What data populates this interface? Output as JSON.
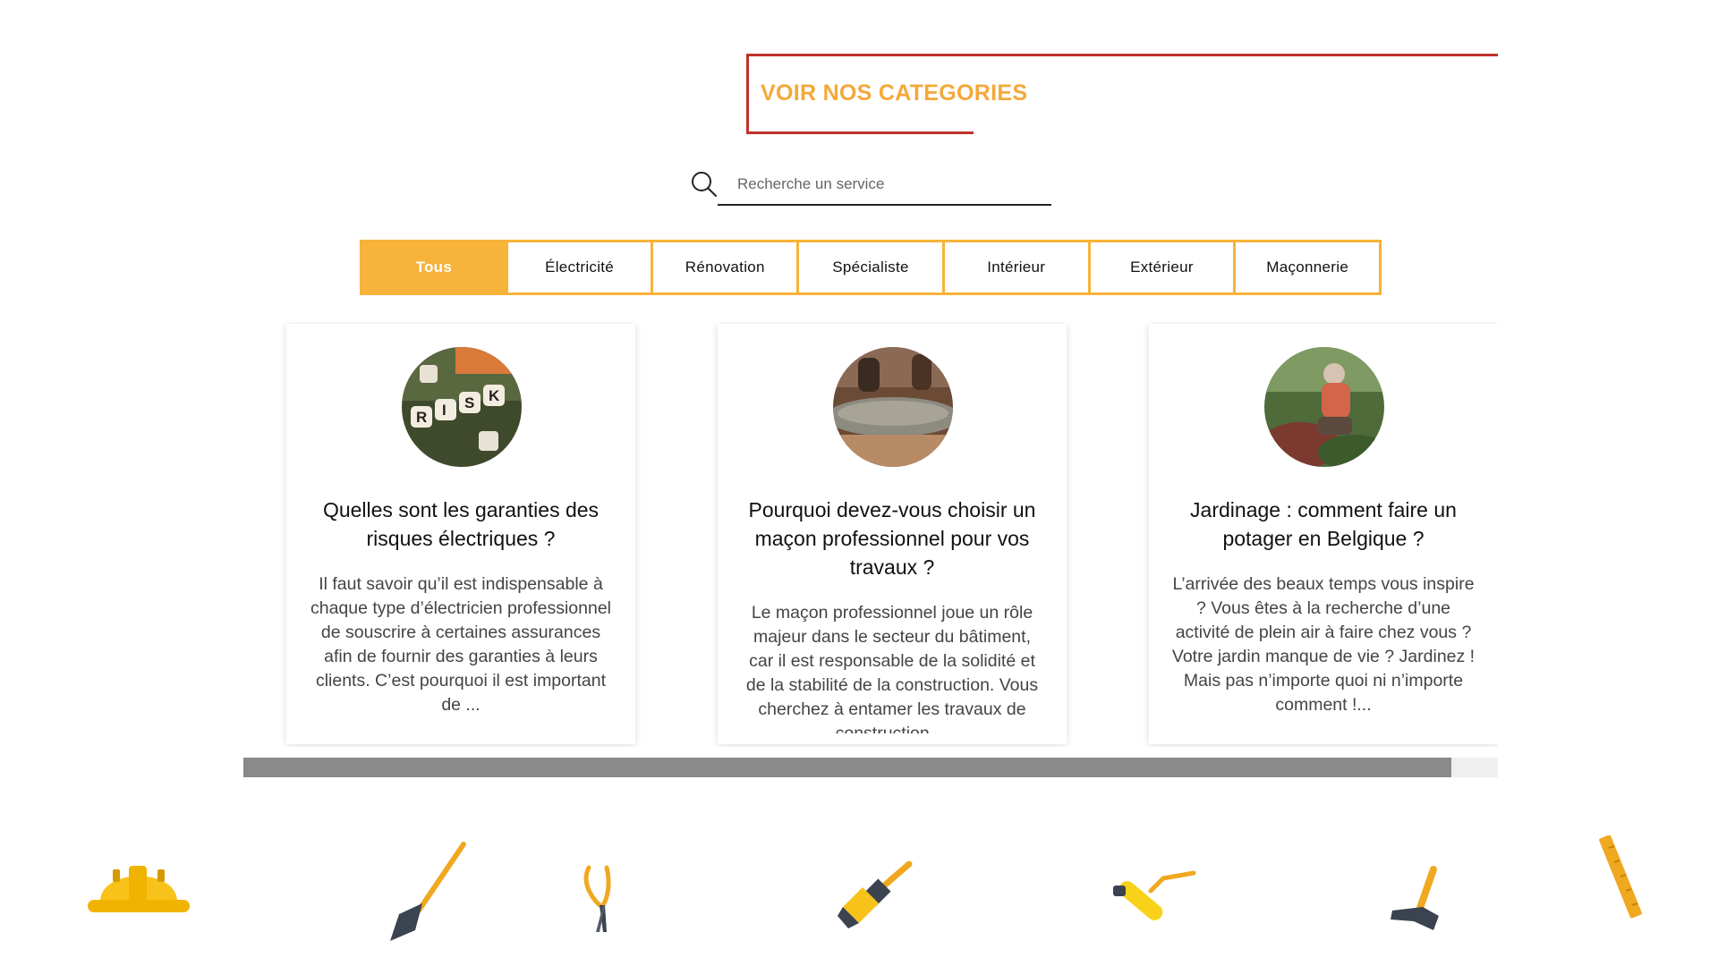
{
  "heading": {
    "title": "VOIR NOS CATEGORIES"
  },
  "search": {
    "placeholder": "Recherche un service"
  },
  "tabs": [
    {
      "label": "Tous",
      "active": true
    },
    {
      "label": "Électricité",
      "active": false
    },
    {
      "label": "Rénovation",
      "active": false
    },
    {
      "label": "Spécialiste",
      "active": false
    },
    {
      "label": "Intérieur",
      "active": false
    },
    {
      "label": "Extérieur",
      "active": false
    },
    {
      "label": "Maçonnerie",
      "active": false
    }
  ],
  "cards": [
    {
      "title": "Quelles sont les garanties des risques électriques ?",
      "excerpt": "Il faut savoir qu’il est indispensable à chaque type d’électricien professionnel de souscrire à certaines assurances afin de fournir des garanties à leurs clients. C’est pourquoi il est important de ...",
      "image": "risk-letter-tiles"
    },
    {
      "title": "Pourquoi devez-vous choisir un maçon professionnel pour vos travaux ?",
      "excerpt": "Le maçon professionnel joue un rôle majeur dans le secteur du bâtiment, car il est responsable de la solidité et de la stabilité de la construction. Vous cherchez à entamer les travaux de construction ...",
      "image": "mason-concrete"
    },
    {
      "title": "Jardinage : comment faire un potager en Belgique ?",
      "excerpt": "L’arrivée des beaux temps vous inspire ? Vous êtes à la recherche d’une activité de plein air à faire chez vous ? Votre jardin manque de vie ? Jardinez ! Mais pas n’importe quoi ni n’importe comment !...",
      "image": "woman-gardening"
    }
  ],
  "scroll": {
    "position_fraction": 0.96
  },
  "colors": {
    "accent": "#f7b33a",
    "heading": "#f4a83a",
    "border_red": "#c0312b"
  },
  "tools": [
    "hard-hat-icon",
    "trowel-icon",
    "pliers-icon",
    "paintbrush-icon",
    "paint-roller-icon",
    "hammer-icon",
    "ruler-icon"
  ]
}
